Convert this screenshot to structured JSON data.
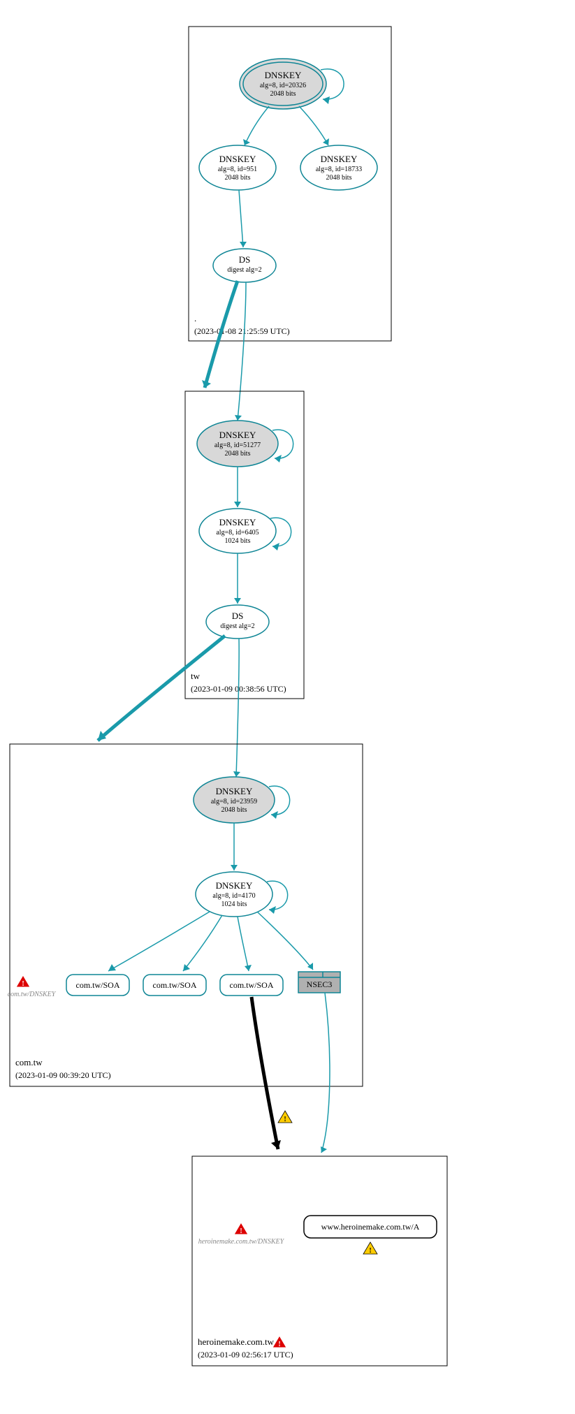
{
  "colors": {
    "teal": "#0e8595",
    "grey": "#d8d8d8"
  },
  "zones": {
    "root": {
      "label": ".",
      "timestamp": "(2023-01-08 21:25:59 UTC)"
    },
    "tw": {
      "label": "tw",
      "timestamp": "(2023-01-09 00:38:56 UTC)"
    },
    "comtw": {
      "label": "com.tw",
      "timestamp": "(2023-01-09 00:39:20 UTC)"
    },
    "heroine": {
      "label": "heroinemake.com.tw",
      "timestamp": "(2023-01-09 02:56:17 UTC)"
    }
  },
  "nodes": {
    "root_ksk": {
      "title": "DNSKEY",
      "line1": "alg=8, id=20326",
      "line2": "2048 bits"
    },
    "root_zsk1": {
      "title": "DNSKEY",
      "line1": "alg=8, id=951",
      "line2": "2048 bits"
    },
    "root_zsk2": {
      "title": "DNSKEY",
      "line1": "alg=8, id=18733",
      "line2": "2048 bits"
    },
    "root_ds": {
      "title": "DS",
      "line1": "digest alg=2"
    },
    "tw_ksk": {
      "title": "DNSKEY",
      "line1": "alg=8, id=51277",
      "line2": "2048 bits"
    },
    "tw_zsk": {
      "title": "DNSKEY",
      "line1": "alg=8, id=6405",
      "line2": "1024 bits"
    },
    "tw_ds": {
      "title": "DS",
      "line1": "digest alg=2"
    },
    "comtw_ksk": {
      "title": "DNSKEY",
      "line1": "alg=8, id=23959",
      "line2": "2048 bits"
    },
    "comtw_zsk": {
      "title": "DNSKEY",
      "line1": "alg=8, id=4170",
      "line2": "1024 bits"
    },
    "soa1": {
      "label": "com.tw/SOA"
    },
    "soa2": {
      "label": "com.tw/SOA"
    },
    "soa3": {
      "label": "com.tw/SOA"
    },
    "nsec3": {
      "label": "NSEC3"
    },
    "heroine_a": {
      "label": "www.heroinemake.com.tw/A"
    }
  },
  "faded": {
    "comtw_dnskey": "com.tw/DNSKEY",
    "heroine_dnskey": "heroinemake.com.tw/DNSKEY"
  }
}
